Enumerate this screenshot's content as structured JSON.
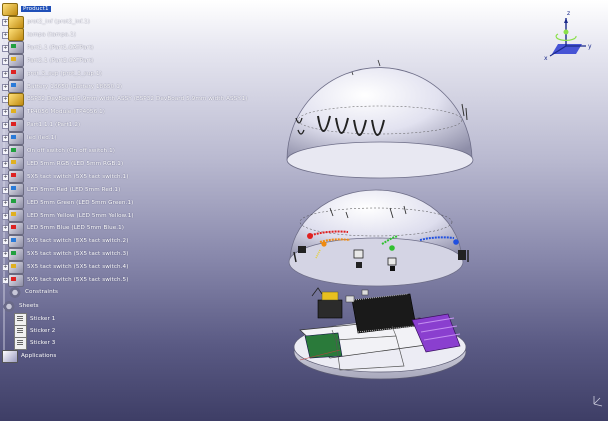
{
  "tree": {
    "root": "Product1",
    "items": [
      {
        "label": "prot2_inf (prot2_inf.1)",
        "icon": "product-icon"
      },
      {
        "label": "tampa (tampa.1)",
        "icon": "product-icon"
      },
      {
        "label": "Part1.1 (Part1.CATPart)",
        "icon": "part-icon"
      },
      {
        "label": "Part2.1 (Part2.CATPart)",
        "icon": "part-icon"
      },
      {
        "label": "prot_3_sup (prot_3_sup.1)",
        "icon": "part-icon"
      },
      {
        "label": "Battery 18650 (Battery 18650.1)",
        "icon": "part-icon"
      },
      {
        "label": "ESP32 DevBoard 5.9mm width ASSY (ESP32 DevBoard 5.9mm width ASSY.1)",
        "icon": "product-icon"
      },
      {
        "label": "TP4056 Module (TP4056.1)",
        "icon": "part-icon"
      },
      {
        "label": "Part1.1.1 (Part1.2)",
        "icon": "part-icon"
      },
      {
        "label": "led (led.1)",
        "icon": "part-icon"
      },
      {
        "label": "On off switch (On off switch.1)",
        "icon": "part-icon"
      },
      {
        "label": "LED 5mm RGB (LED 5mm RGB.1)",
        "icon": "part-icon"
      },
      {
        "label": "5X5 tact switch (5X5 tact switch.1)",
        "icon": "part-icon"
      },
      {
        "label": "LED 5mm Red (LED 5mm Red.1)",
        "icon": "part-icon"
      },
      {
        "label": "LED 5mm Green (LED 5mm Green.1)",
        "icon": "part-icon"
      },
      {
        "label": "LED 5mm Yellow (LED 5mm Yellow.1)",
        "icon": "part-icon"
      },
      {
        "label": "LED 5mm Blue (LED 5mm Blue.1)",
        "icon": "part-icon"
      },
      {
        "label": "5X5 tact switch (5X5 tact switch.2)",
        "icon": "part-icon"
      },
      {
        "label": "5X5 tact switch (5X5 tact switch.3)",
        "icon": "part-icon"
      },
      {
        "label": "5X5 tact switch (5X5 tact switch.4)",
        "icon": "part-icon"
      },
      {
        "label": "5X5 tact switch (5X5 tact switch.5)",
        "icon": "part-icon"
      }
    ],
    "constraints": "Constraints",
    "sheets_group": "Sheets",
    "sheets": [
      "Sticker 1",
      "Sticker 2",
      "Sticker 3"
    ],
    "applications": "Applications"
  },
  "compass": {
    "axis_z": "z",
    "axis_y": "y",
    "axis_x": "x"
  },
  "colors": {
    "selection": "#1f4fb8",
    "dome": "#e2e2f0",
    "base": "#d8d8e4",
    "purple_battery": "#8a3fcf",
    "led_red": "#e02020",
    "led_orange": "#f08a10",
    "led_green": "#30c030",
    "led_blue": "#2050e0",
    "led_yellow": "#e8d020"
  }
}
